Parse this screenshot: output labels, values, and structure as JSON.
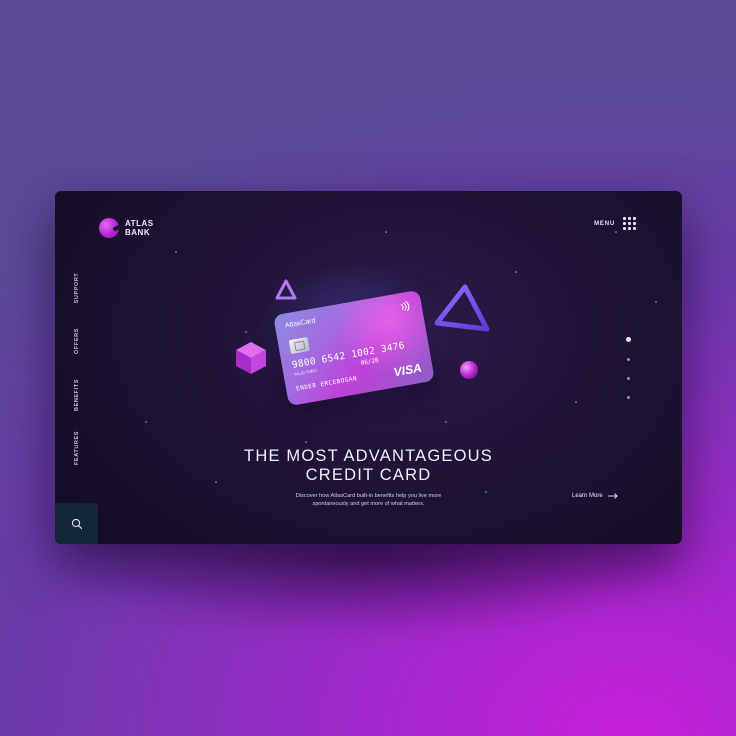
{
  "brand": {
    "line1": "ATLAS",
    "line2": "BANK"
  },
  "menu": {
    "label": "MENU"
  },
  "side_nav": {
    "items": [
      "SUPPORT",
      "OFFERS",
      "BENEFITS",
      "FEATURES"
    ]
  },
  "card": {
    "brand": "AtlasCard",
    "number": "9800 6542 1002 3476",
    "valid_label": "VALID THRU",
    "expiry": "06/28",
    "holder": "ENDER ERCEBOGAN",
    "network": "VISA"
  },
  "hero": {
    "headline_line1": "THE MOST ADVANTAGEOUS",
    "headline_line2": "CREDIT CARD",
    "description_line1": "Discover how AtlasCard built-in benefits help you live more",
    "description_line2": "spontaneously and get more of what matters."
  },
  "cta": {
    "learn_more": "Learn More"
  },
  "slider": {
    "total": 4,
    "active_index": 0
  },
  "colors": {
    "accent": "#b325d4",
    "background_dark": "#1e1233",
    "search_box": "#12273a"
  },
  "icons": [
    "atlas-logo-icon",
    "menu-grid-icon",
    "search-icon",
    "contactless-icon",
    "arrow-right-icon"
  ]
}
